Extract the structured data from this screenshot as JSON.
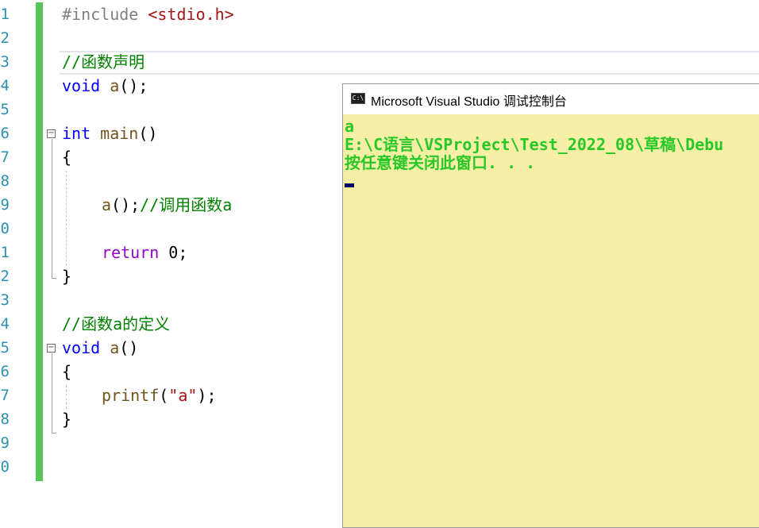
{
  "editor": {
    "line_numbers": [
      "1",
      "2",
      "3",
      "4",
      "5",
      "6",
      "7",
      "8",
      "9",
      "0",
      "1",
      "2",
      "3",
      "4",
      "5",
      "6",
      "7",
      "8",
      "9",
      "0"
    ],
    "include_directive": "#include",
    "include_header": "<stdio.h>",
    "comment_decl": "//函数声明",
    "decl_type": "void",
    "decl_name": "a",
    "decl_rest": "();",
    "main_type": "int",
    "main_name": "main",
    "main_parens": "()",
    "open_brace": "{",
    "close_brace": "}",
    "call_name": "a",
    "call_rest": "();",
    "call_comment": "//调用函数a",
    "return_kw": "return",
    "return_value": "0;",
    "comment_def": "//函数a的定义",
    "def_type": "void",
    "def_name": "a",
    "def_parens": "()",
    "printf_name": "printf",
    "printf_open": "(",
    "printf_arg": "\"a\"",
    "printf_close": ");",
    "collapse_glyph": "−"
  },
  "console": {
    "icon_text": "C:\\",
    "title": "Microsoft Visual Studio 调试控制台",
    "lines": [
      "a",
      "E:\\C语言\\VSProject\\Test_2022_08\\草稿\\Debu",
      "按任意键关闭此窗口. . ."
    ]
  },
  "colors": {
    "keyword": "#0000ff",
    "control_keyword": "#8f08c4",
    "function": "#74531f",
    "comment": "#008000",
    "string": "#a31515",
    "console_bg": "#f7efa5",
    "console_text": "#28c828",
    "change_bar": "#57c557"
  }
}
